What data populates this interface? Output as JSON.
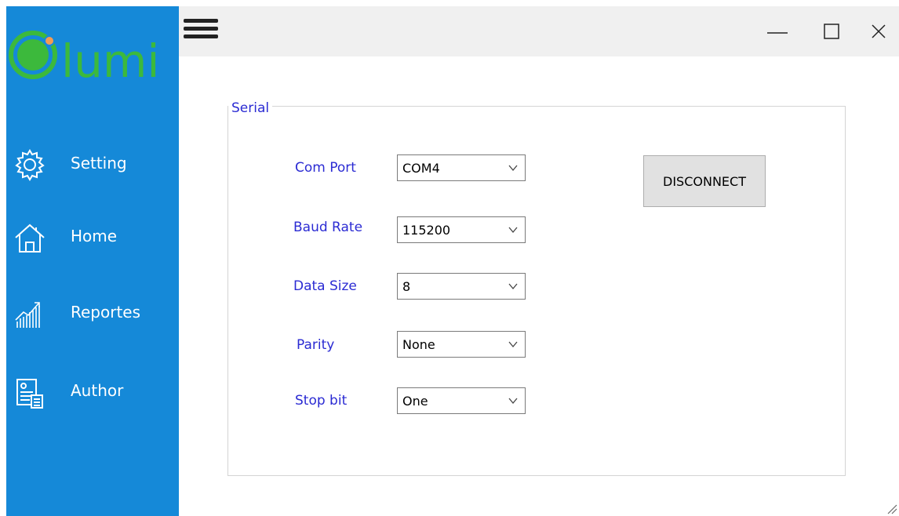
{
  "app": {
    "logo_text": "lumi",
    "accent": "#1589d8",
    "logo_color": "#3cb93c",
    "logo_dot": "#f39c52"
  },
  "sidebar": {
    "items": [
      {
        "label": "Setting",
        "icon": "gear-icon"
      },
      {
        "label": "Home",
        "icon": "home-icon"
      },
      {
        "label": "Reportes",
        "icon": "chart-icon"
      },
      {
        "label": "Author",
        "icon": "author-icon"
      }
    ]
  },
  "serial": {
    "legend": "Serial",
    "com_port": {
      "label": "Com Port",
      "value": "COM4"
    },
    "baud_rate": {
      "label": "Baud Rate",
      "value": "115200"
    },
    "data_size": {
      "label": "Data Size",
      "value": "8"
    },
    "parity": {
      "label": "Parity",
      "value": "None"
    },
    "stop_bit": {
      "label": "Stop bit",
      "value": "One"
    },
    "disconnect_label": "DISCONNECT"
  }
}
